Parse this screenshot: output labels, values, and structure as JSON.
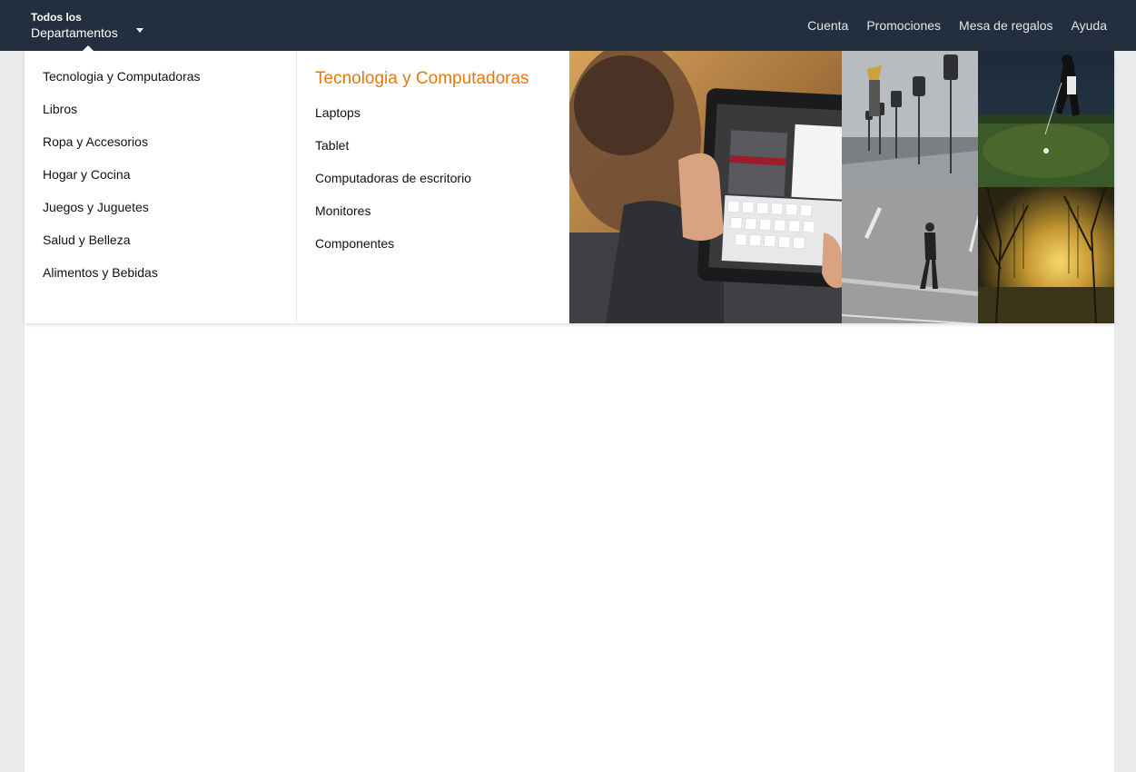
{
  "header": {
    "dept_line1": "Todos los",
    "dept_line2": "Departamentos",
    "nav": [
      {
        "label": "Cuenta"
      },
      {
        "label": "Promociones"
      },
      {
        "label": "Mesa de regalos"
      },
      {
        "label": "Ayuda"
      }
    ]
  },
  "flyout": {
    "categories": [
      {
        "label": "Tecnologia y Computadoras"
      },
      {
        "label": "Libros"
      },
      {
        "label": "Ropa y Accesorios"
      },
      {
        "label": "Hogar y Cocina"
      },
      {
        "label": "Juegos y Juguetes"
      },
      {
        "label": "Salud y Belleza"
      },
      {
        "label": "Alimentos y Bebidas"
      }
    ],
    "subcategory_title": "Tecnologia y Computadoras",
    "subcategories": [
      {
        "label": "Laptops"
      },
      {
        "label": "Tablet"
      },
      {
        "label": "Computadoras de escritorio"
      },
      {
        "label": "Monitores"
      },
      {
        "label": "Componentes"
      }
    ]
  },
  "colors": {
    "topbar": "#232f3e",
    "accent": "#e47911",
    "page_bg": "#eaebed"
  }
}
